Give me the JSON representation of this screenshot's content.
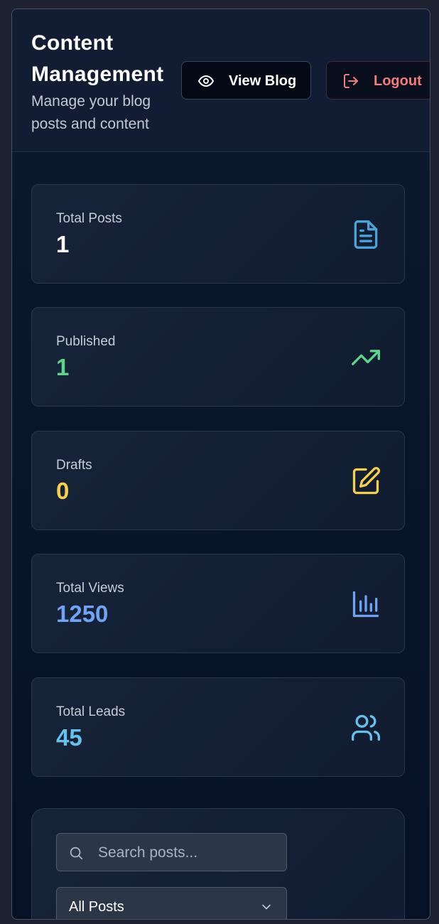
{
  "header": {
    "title": "Content Management",
    "subtitle": "Manage your blog posts and content",
    "view_blog_label": "View Blog",
    "logout_label": "Logout"
  },
  "stats": [
    {
      "label": "Total Posts",
      "value": "1",
      "color": "#ffffff",
      "icon": "document-icon",
      "icon_color": "#4aa3d9"
    },
    {
      "label": "Published",
      "value": "1",
      "color": "#5cd68a",
      "icon": "trending-up-icon",
      "icon_color": "#5cd68a"
    },
    {
      "label": "Drafts",
      "value": "0",
      "color": "#f5d04c",
      "icon": "edit-icon",
      "icon_color": "#f5d04c"
    },
    {
      "label": "Total Views",
      "value": "1250",
      "color": "#6fa4f5",
      "icon": "bar-chart-icon",
      "icon_color": "#6fa4f5"
    },
    {
      "label": "Total Leads",
      "value": "45",
      "color": "#64c3ee",
      "icon": "users-icon",
      "icon_color": "#64c3ee"
    }
  ],
  "filters": {
    "search_placeholder": "Search posts...",
    "status_selected": "All Posts"
  }
}
